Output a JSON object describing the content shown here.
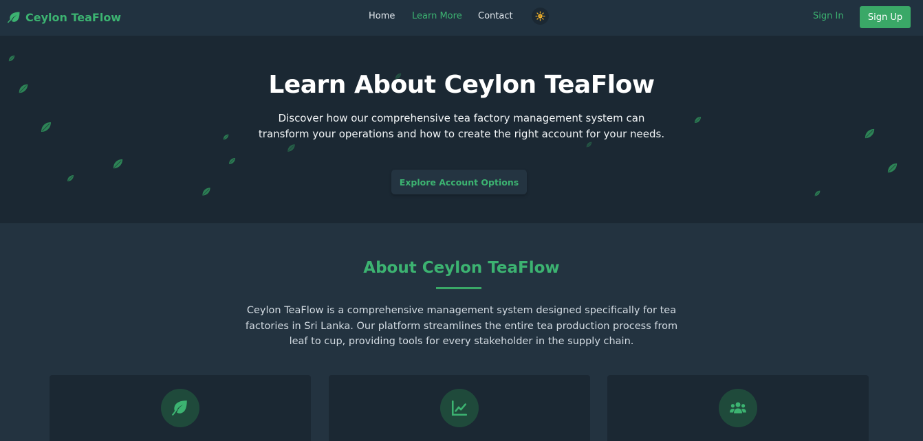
{
  "brand": {
    "name": "Ceylon TeaFlow",
    "icon": "leaf-icon"
  },
  "nav": {
    "links": [
      {
        "label": "Home",
        "active": false
      },
      {
        "label": "Learn More",
        "active": true
      },
      {
        "label": "Contact",
        "active": false
      }
    ],
    "theme_icon": "sun-icon",
    "sign_in": "Sign In",
    "sign_up": "Sign Up"
  },
  "hero": {
    "title": "Learn About Ceylon TeaFlow",
    "subtitle": "Discover how our comprehensive tea factory management system can transform your operations and how to create the right account for your needs.",
    "button": "Explore Account Options"
  },
  "about": {
    "title": "About Ceylon TeaFlow",
    "text": "Ceylon TeaFlow is a comprehensive management system designed specifically for tea factories in Sri Lanka. Our platform streamlines the entire tea production process from leaf to cup, providing tools for every stakeholder in the supply chain."
  },
  "cards": [
    {
      "icon": "leaf-icon"
    },
    {
      "icon": "chart-line-icon"
    },
    {
      "icon": "users-icon"
    }
  ],
  "colors": {
    "accent": "#3cb371",
    "navbar_bg": "#213240",
    "hero_bg": "#1b2833",
    "page_bg": "#233340",
    "button_green": "#3aa867"
  }
}
